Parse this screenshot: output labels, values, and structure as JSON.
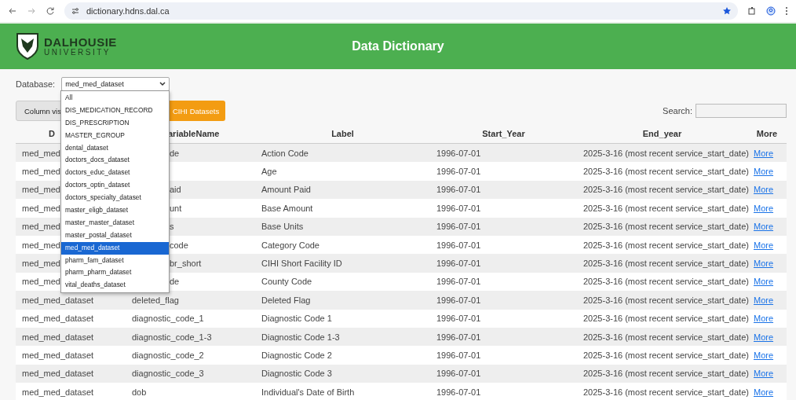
{
  "browser": {
    "url": "dictionary.hdns.dal.ca"
  },
  "header": {
    "logo_top": "DALHOUSIE",
    "logo_bottom": "UNIVERSITY",
    "title": "Data Dictionary"
  },
  "database": {
    "label": "Database:",
    "value": "med_med_dataset",
    "options": [
      {
        "label": "All",
        "selected": false
      },
      {
        "label": "DIS_MEDICATION_RECORD",
        "selected": false
      },
      {
        "label": "DIS_PRESCRIPTION",
        "selected": false
      },
      {
        "label": "MASTER_EGROUP",
        "selected": false
      },
      {
        "label": "dental_dataset",
        "selected": false
      },
      {
        "label": "doctors_docs_dataset",
        "selected": false
      },
      {
        "label": "doctors_educ_dataset",
        "selected": false
      },
      {
        "label": "doctors_optin_dataset",
        "selected": false
      },
      {
        "label": "doctors_specialty_dataset",
        "selected": false
      },
      {
        "label": "master_eligb_dataset",
        "selected": false
      },
      {
        "label": "master_master_dataset",
        "selected": false
      },
      {
        "label": "master_postal_dataset",
        "selected": false
      },
      {
        "label": "med_med_dataset",
        "selected": true
      },
      {
        "label": "pharm_fam_dataset",
        "selected": false
      },
      {
        "label": "pharm_pharm_dataset",
        "selected": false
      },
      {
        "label": "vital_deaths_dataset",
        "selected": false
      }
    ]
  },
  "buttons": {
    "column_visibility": "Column vis",
    "cihi": "CIHI Datasets"
  },
  "search": {
    "label": "Search:"
  },
  "table": {
    "columns": [
      "D",
      "ariableName",
      "Label",
      "Start_Year",
      "End_year",
      "More"
    ],
    "rows": [
      {
        "dataset": "med_med",
        "variable": "de",
        "label": "Action Code",
        "start": "1996-07-01",
        "end": "2025-3-16 (most recent service_start_date)",
        "more": "More"
      },
      {
        "dataset": "med_med",
        "label": "Age",
        "start": "1996-07-01",
        "end": "2025-3-16 (most recent service_start_date)",
        "more": "More"
      },
      {
        "dataset": "med_med",
        "variable": "aid",
        "label": "Amount Paid",
        "start": "1996-07-01",
        "end": "2025-3-16 (most recent service_start_date)",
        "more": "More"
      },
      {
        "dataset": "med_med",
        "variable": "unt",
        "label": "Base Amount",
        "start": "1996-07-01",
        "end": "2025-3-16 (most recent service_start_date)",
        "more": "More"
      },
      {
        "dataset": "med_med",
        "variable": "s",
        "label": "Base Units",
        "start": "1996-07-01",
        "end": "2025-3-16 (most recent service_start_date)",
        "more": "More"
      },
      {
        "dataset": "med_med",
        "variable": "code",
        "label": "Category Code",
        "start": "1996-07-01",
        "end": "2025-3-16 (most recent service_start_date)",
        "more": "More"
      },
      {
        "dataset": "med_med",
        "variable": "br_short",
        "label": "CIHI Short Facility ID",
        "start": "1996-07-01",
        "end": "2025-3-16 (most recent service_start_date)",
        "more": "More"
      },
      {
        "dataset": "med_med",
        "variable": "de",
        "label": "County Code",
        "start": "1996-07-01",
        "end": "2025-3-16 (most recent service_start_date)",
        "more": "More"
      },
      {
        "dataset": "med_med_dataset",
        "variable": "deleted_flag",
        "label": "Deleted Flag",
        "start": "1996-07-01",
        "end": "2025-3-16 (most recent service_start_date)",
        "more": "More"
      },
      {
        "dataset": "med_med_dataset",
        "variable": "diagnostic_code_1",
        "label": "Diagnostic Code 1",
        "start": "1996-07-01",
        "end": "2025-3-16 (most recent service_start_date)",
        "more": "More"
      },
      {
        "dataset": "med_med_dataset",
        "variable": "diagnostic_code_1-3",
        "label": "Diagnostic Code 1-3",
        "start": "1996-07-01",
        "end": "2025-3-16 (most recent service_start_date)",
        "more": "More"
      },
      {
        "dataset": "med_med_dataset",
        "variable": "diagnostic_code_2",
        "label": "Diagnostic Code 2",
        "start": "1996-07-01",
        "end": "2025-3-16 (most recent service_start_date)",
        "more": "More"
      },
      {
        "dataset": "med_med_dataset",
        "variable": "diagnostic_code_3",
        "label": "Diagnostic Code 3",
        "start": "1996-07-01",
        "end": "2025-3-16 (most recent service_start_date)",
        "more": "More"
      },
      {
        "dataset": "med_med_dataset",
        "variable": "dob",
        "label": "Individual's Date of Birth",
        "start": "1996-07-01",
        "end": "2025-3-16 (most recent service_start_date)",
        "more": "More"
      }
    ]
  }
}
